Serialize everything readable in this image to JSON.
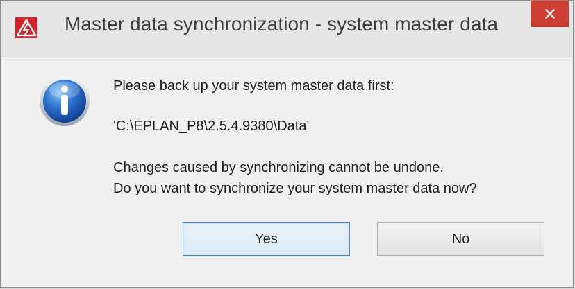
{
  "window": {
    "title": "Master data synchronization - system master data",
    "app_icon": "eplan-warning-triangle-icon",
    "close_icon": "close-icon",
    "colors": {
      "close_button": "#cd3d32",
      "app_icon_red": "#d2232a",
      "titlebar": "#e6e6e6",
      "content": "#f0f0f0",
      "focus_border": "#3a8ad8"
    }
  },
  "dialog": {
    "icon": "info-icon",
    "message_line1": "Please back up your system master data first:",
    "path": "'C:\\EPLAN_P8\\2.5.4.9380\\Data'",
    "message_line3": "Changes caused by synchronizing cannot be undone.",
    "message_line4": "Do you want to synchronize your system master data now?"
  },
  "buttons": {
    "yes_label": "Yes",
    "no_label": "No"
  }
}
